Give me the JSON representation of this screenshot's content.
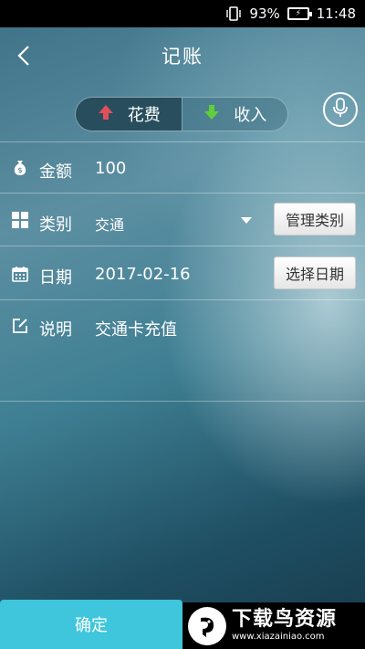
{
  "status_bar": {
    "battery": "93%",
    "time": "11:48"
  },
  "header": {
    "title": "记账"
  },
  "segment": {
    "expense_label": "花费",
    "income_label": "收入"
  },
  "form": {
    "amount": {
      "label": "金额",
      "value": "100"
    },
    "category": {
      "label": "类别",
      "value": "交通",
      "manage_label": "管理类别"
    },
    "date": {
      "label": "日期",
      "value": "2017-02-16",
      "pick_label": "选择日期"
    },
    "note": {
      "label": "说明",
      "value": "交通卡充值"
    }
  },
  "footer": {
    "confirm_label": "确定"
  },
  "watermark": {
    "title": "下载鸟资源",
    "url": "www.xiazainiao.com"
  },
  "colors": {
    "confirm": "#3fc6dc",
    "expense_arrow": "#e0505a",
    "income_arrow": "#5fcf3a"
  },
  "icons": [
    "vibrate-icon",
    "battery-icon",
    "back-icon",
    "up-arrow-icon",
    "down-arrow-icon",
    "mic-icon",
    "money-bag-icon",
    "grid-icon",
    "calendar-icon",
    "edit-icon"
  ]
}
